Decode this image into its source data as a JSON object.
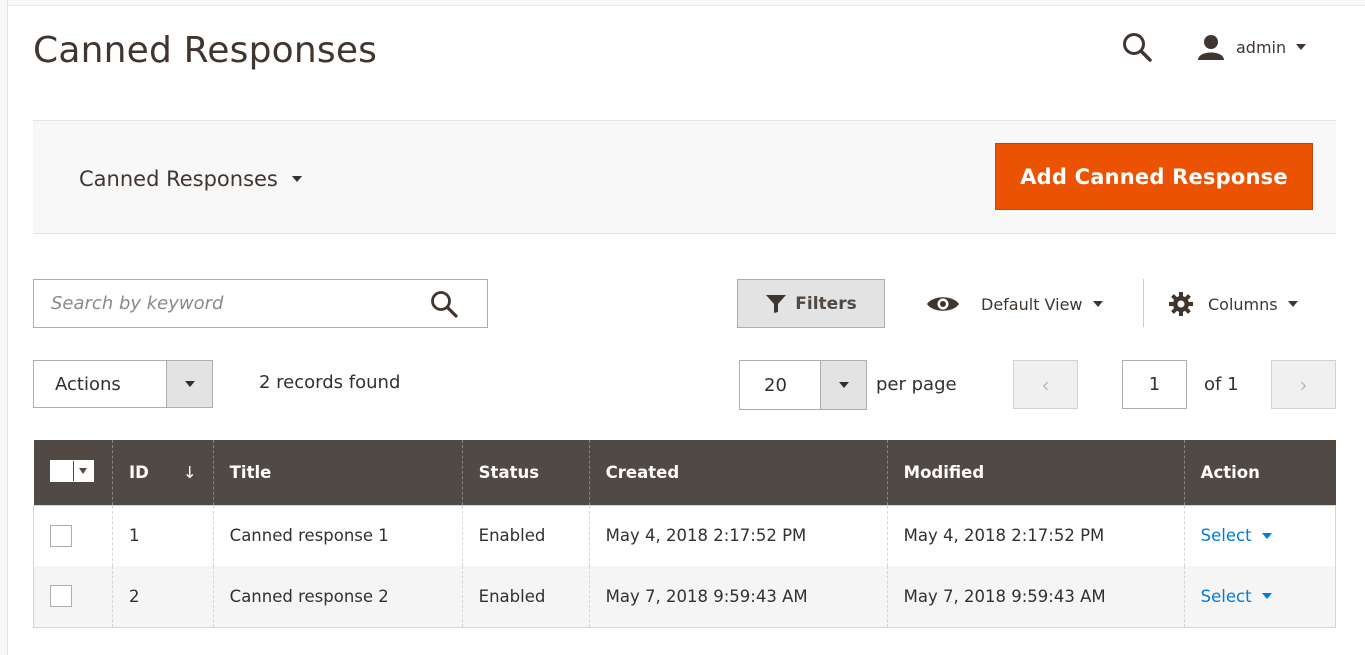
{
  "header": {
    "title": "Canned Responses",
    "user": "admin"
  },
  "action_bar": {
    "switcher_label": "Canned Responses",
    "add_button": "Add Canned Response"
  },
  "toolbar": {
    "search_placeholder": "Search by keyword",
    "filters_label": "Filters",
    "view_label": "Default View",
    "columns_label": "Columns"
  },
  "grid_controls": {
    "actions_label": "Actions",
    "records_found": "2 records found",
    "per_page_value": "20",
    "per_page_label": "per page",
    "prev_symbol": "‹",
    "next_symbol": "›",
    "current_page": "1",
    "page_of": "of 1"
  },
  "table": {
    "columns": [
      "ID",
      "Title",
      "Status",
      "Created",
      "Modified",
      "Action"
    ],
    "sort_indicator": "↓",
    "rows": [
      {
        "id": "1",
        "title": "Canned response 1",
        "status": "Enabled",
        "created": "May 4, 2018 2:17:52 PM",
        "modified": "May 4, 2018 2:17:52 PM",
        "action": "Select"
      },
      {
        "id": "2",
        "title": "Canned response 2",
        "status": "Enabled",
        "created": "May 7, 2018 9:59:43 AM",
        "modified": "May 7, 2018 9:59:43 AM",
        "action": "Select"
      }
    ]
  },
  "colors": {
    "accent": "#eb5202",
    "table_header": "#514943",
    "link": "#007bdb"
  },
  "icons": {
    "header_search": "search-icon",
    "user": "user-icon",
    "search": "search-icon",
    "filters": "filter-icon",
    "view": "eye-icon",
    "columns": "gear-icon"
  }
}
